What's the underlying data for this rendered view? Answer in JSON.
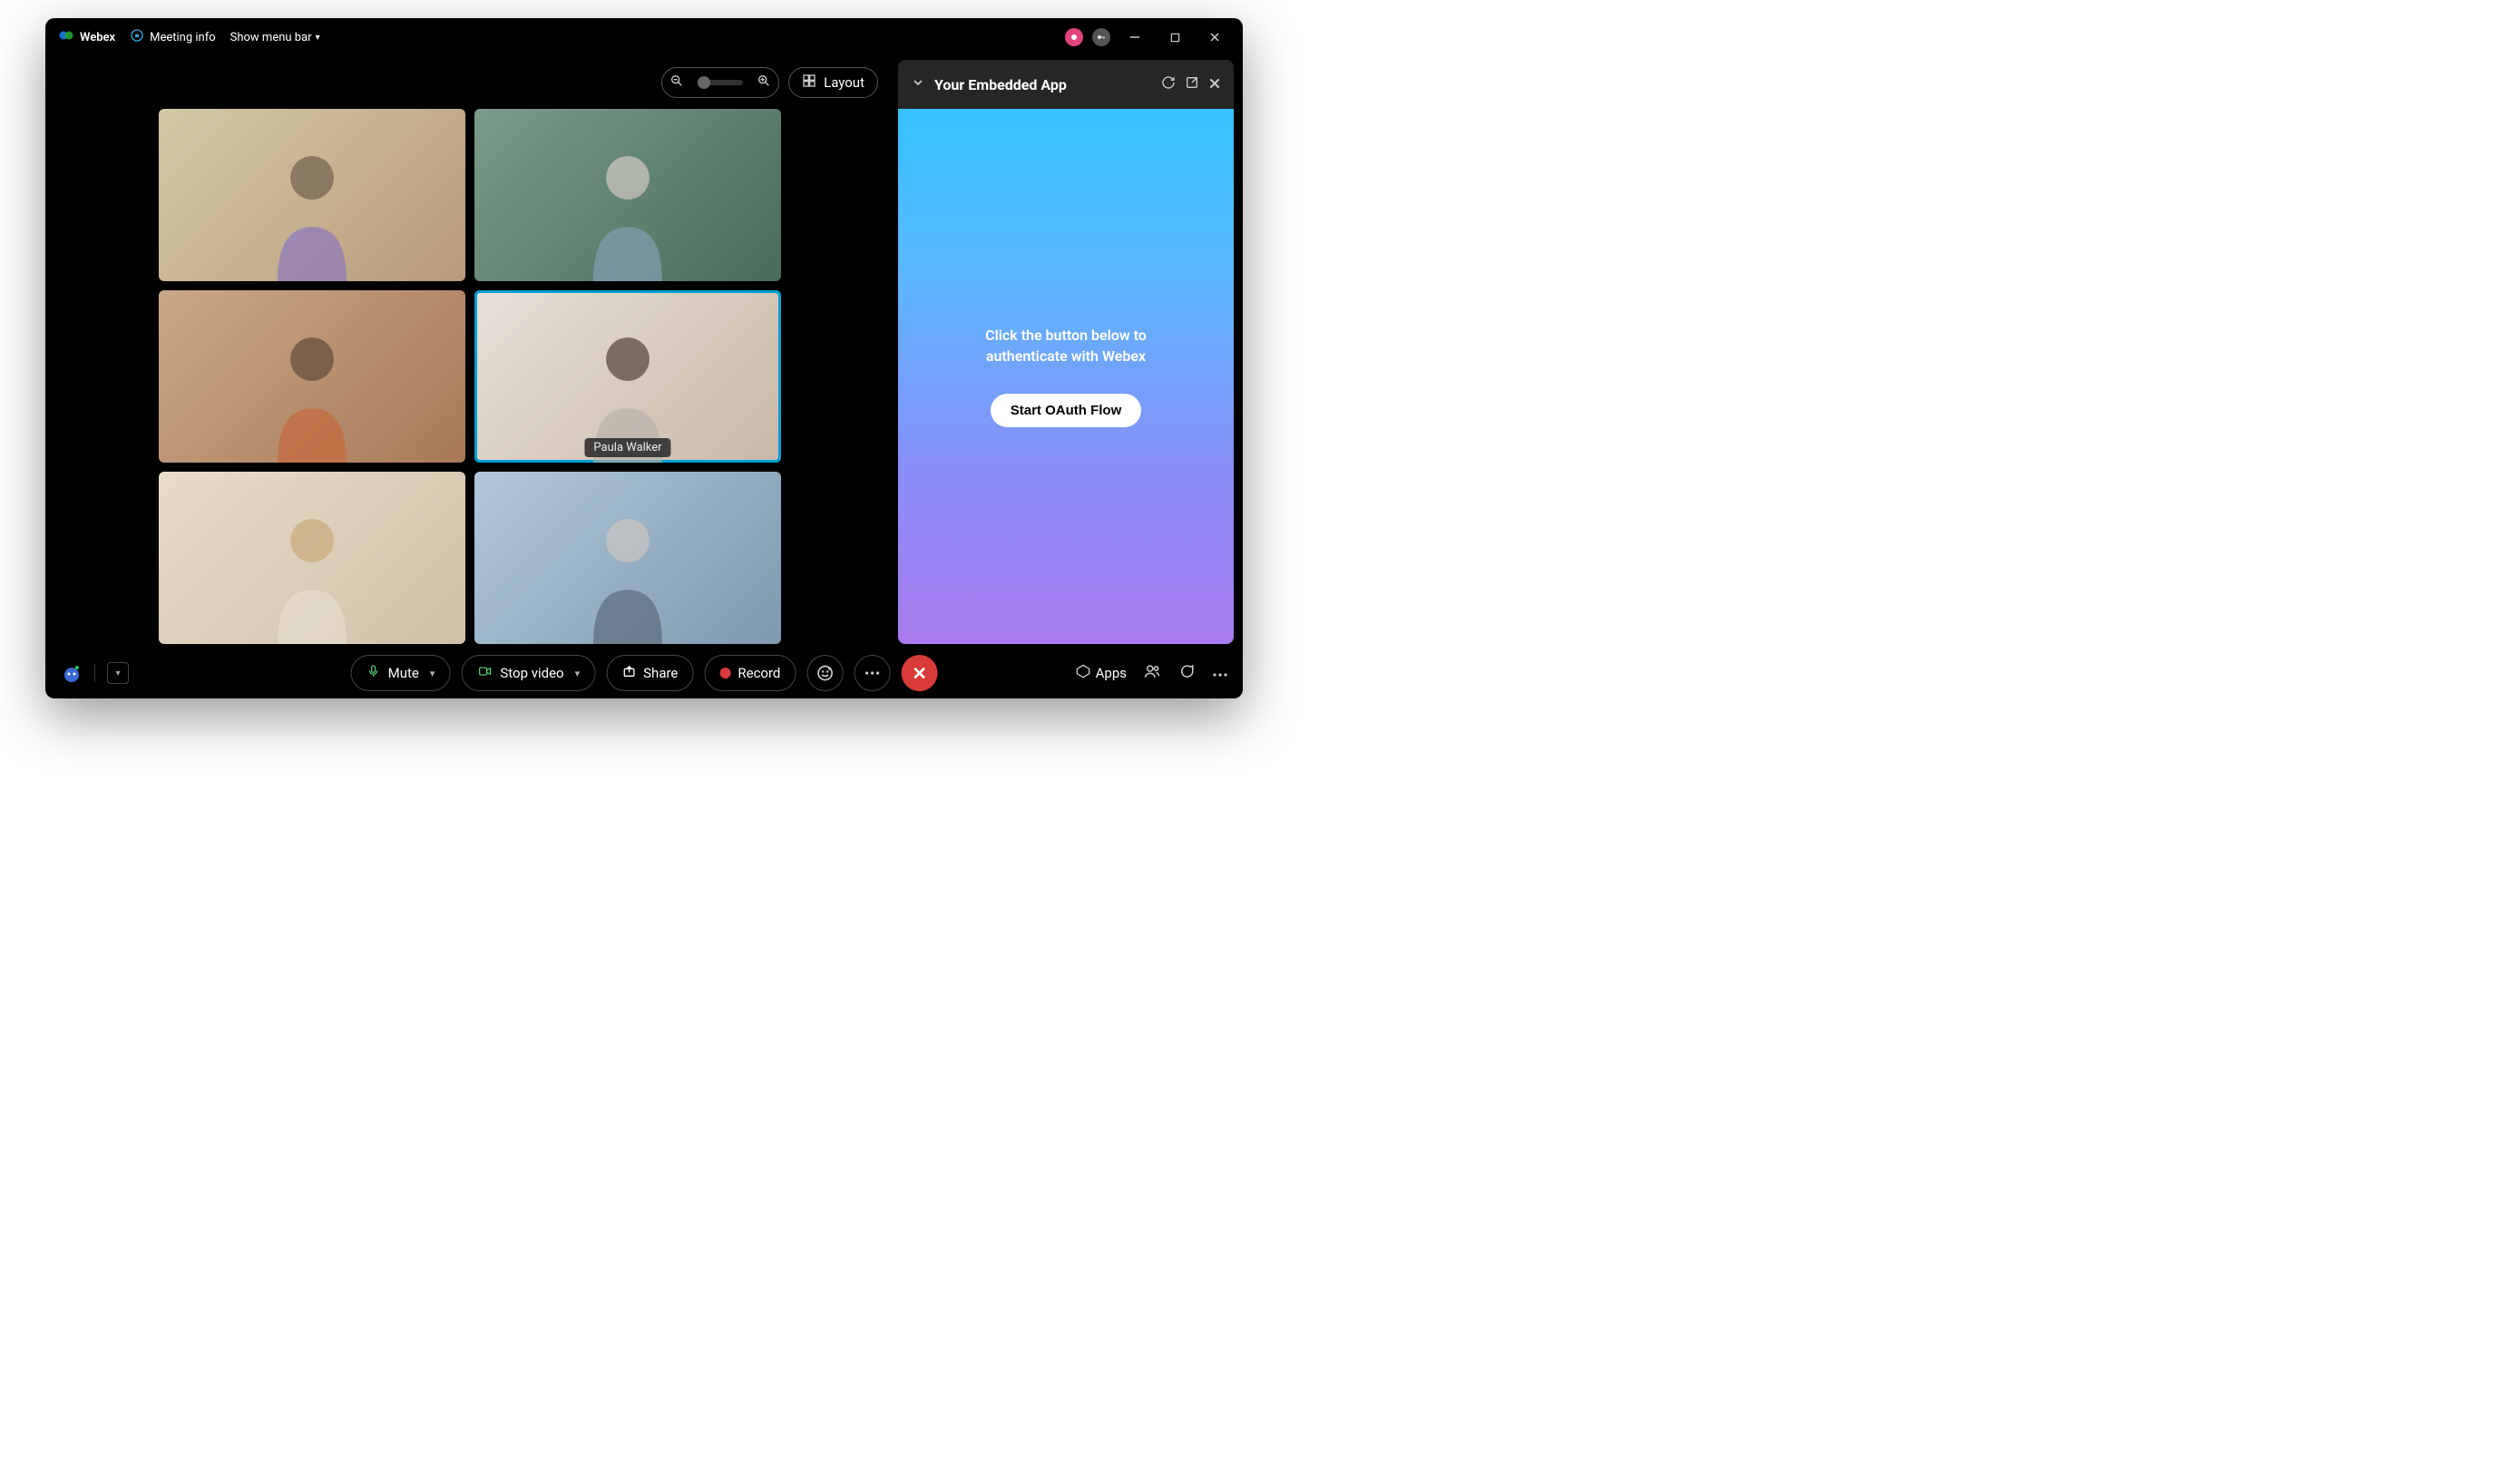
{
  "titlebar": {
    "brand": "Webex",
    "meeting_info": "Meeting info",
    "show_menu": "Show menu bar"
  },
  "layout": {
    "layout_label": "Layout"
  },
  "participants": {
    "active_name": "Paula Walker"
  },
  "panel": {
    "title": "Your Embedded App",
    "message": "Click the button below to authenticate with Webex",
    "button": "Start OAuth Flow"
  },
  "controls": {
    "mute": "Mute",
    "stop_video": "Stop video",
    "share": "Share",
    "record": "Record",
    "apps": "Apps"
  }
}
